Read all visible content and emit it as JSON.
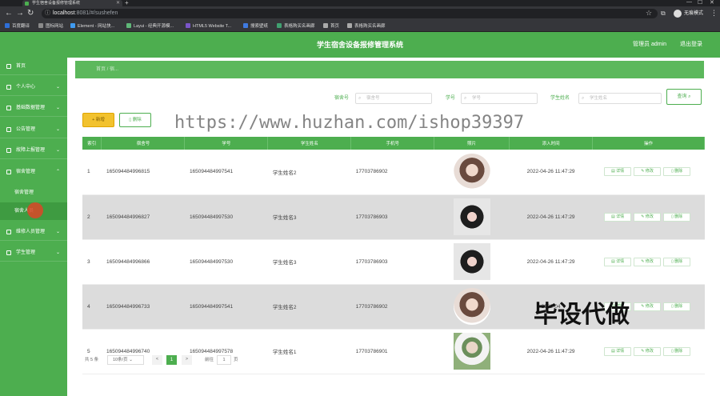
{
  "browser": {
    "tab_title": "学生宿舍设备报修管理系统",
    "url_host": "localhost",
    "url_path": ":8081/#/sushefen",
    "incognito_label": "无痕模式",
    "bookmarks": [
      {
        "label": "百度翻译",
        "color": "#2e6fd8"
      },
      {
        "label": "图标网站",
        "color": "#8a8a8a"
      },
      {
        "label": "Element - 网站快...",
        "color": "#3f9bf0"
      },
      {
        "label": "Layui - 经典开源模...",
        "color": "#5fb878"
      },
      {
        "label": "HTML5 Website T...",
        "color": "#7a55c8"
      },
      {
        "label": "搜索壁纸",
        "color": "#3f7ae0"
      },
      {
        "label": "表格购买名画廊",
        "color": "#40a070"
      },
      {
        "label": "首页",
        "color": "#aaaaaa"
      },
      {
        "label": "表格购买名画廊",
        "color": "#aaaaaa"
      }
    ]
  },
  "app": {
    "title": "学生宿舍设备报修管理系统",
    "user_label": "管理员 admin",
    "logout_label": "退出登录",
    "accent": "#4dae4f"
  },
  "sidebar": {
    "items": [
      {
        "label": "首页",
        "icon": "home-icon",
        "has_children": false
      },
      {
        "label": "个人中心",
        "icon": "user-icon",
        "has_children": true
      },
      {
        "label": "基础数据管理",
        "icon": "database-icon",
        "has_children": true
      },
      {
        "label": "公告管理",
        "icon": "notice-icon",
        "has_children": true
      },
      {
        "label": "故障上报管理",
        "icon": "report-icon",
        "has_children": true
      },
      {
        "label": "宿舍管理",
        "icon": "building-icon",
        "has_children": true,
        "expanded": true
      }
    ],
    "sub_items": [
      {
        "label": "宿舍管理"
      },
      {
        "label": "宿舍人员"
      }
    ],
    "items_after": [
      {
        "label": "维修人员管理",
        "icon": "wrench-icon",
        "has_children": true
      },
      {
        "label": "学生管理",
        "icon": "student-icon",
        "has_children": true
      }
    ]
  },
  "breadcrumb": {
    "text": "首页 / 宿..."
  },
  "search": {
    "fields": [
      {
        "label": "宿舍号",
        "placeholder": "宿舍号"
      },
      {
        "label": "学号",
        "placeholder": "学号"
      },
      {
        "label": "学生姓名",
        "placeholder": "学生姓名"
      }
    ],
    "query_label": "查询"
  },
  "toolbar": {
    "add_label": "+ 新增",
    "delete_label": "删除"
  },
  "table": {
    "headers": [
      "索引",
      "宿舍号",
      "学号",
      "学生姓名",
      "手机号",
      "照片",
      "添入时间",
      "操作"
    ],
    "rows": [
      {
        "index": "1",
        "dorm_no": "165094484996815",
        "student_no": "165094484997541",
        "name": "学生姓名2",
        "phone": "17703786902",
        "photo": "photo-2",
        "time": "2022-04-26 11:47:29"
      },
      {
        "index": "2",
        "dorm_no": "165094484996827",
        "student_no": "165094484997530",
        "name": "学生姓名3",
        "phone": "17703786903",
        "photo": "photo-3",
        "time": "2022-04-26 11:47:29"
      },
      {
        "index": "3",
        "dorm_no": "165094484996866",
        "student_no": "165094484997530",
        "name": "学生姓名3",
        "phone": "17703786903",
        "photo": "photo-3",
        "time": "2022-04-26 11:47:29"
      },
      {
        "index": "4",
        "dorm_no": "165094484996733",
        "student_no": "165094484997541",
        "name": "学生姓名2",
        "phone": "17703786902",
        "photo": "photo-2",
        "time": "2022-04"
      },
      {
        "index": "5",
        "dorm_no": "165094484996740",
        "student_no": "165094484997578",
        "name": "学生姓名1",
        "phone": "17703786901",
        "photo": "photo-1",
        "time": "2022-04-26 11:47:29"
      }
    ],
    "actions": [
      "详情",
      "修改",
      "删除"
    ]
  },
  "pagination": {
    "total_label": "共 5 条",
    "page_size": "10条/页",
    "prev": "<",
    "current_page": "1",
    "next": ">",
    "goto_label": "前往",
    "goto_value": "1",
    "page_unit": "页"
  },
  "watermarks": {
    "url_text": "https://www.huzhan.com/ishop39397",
    "cn_text": "毕设代做"
  }
}
